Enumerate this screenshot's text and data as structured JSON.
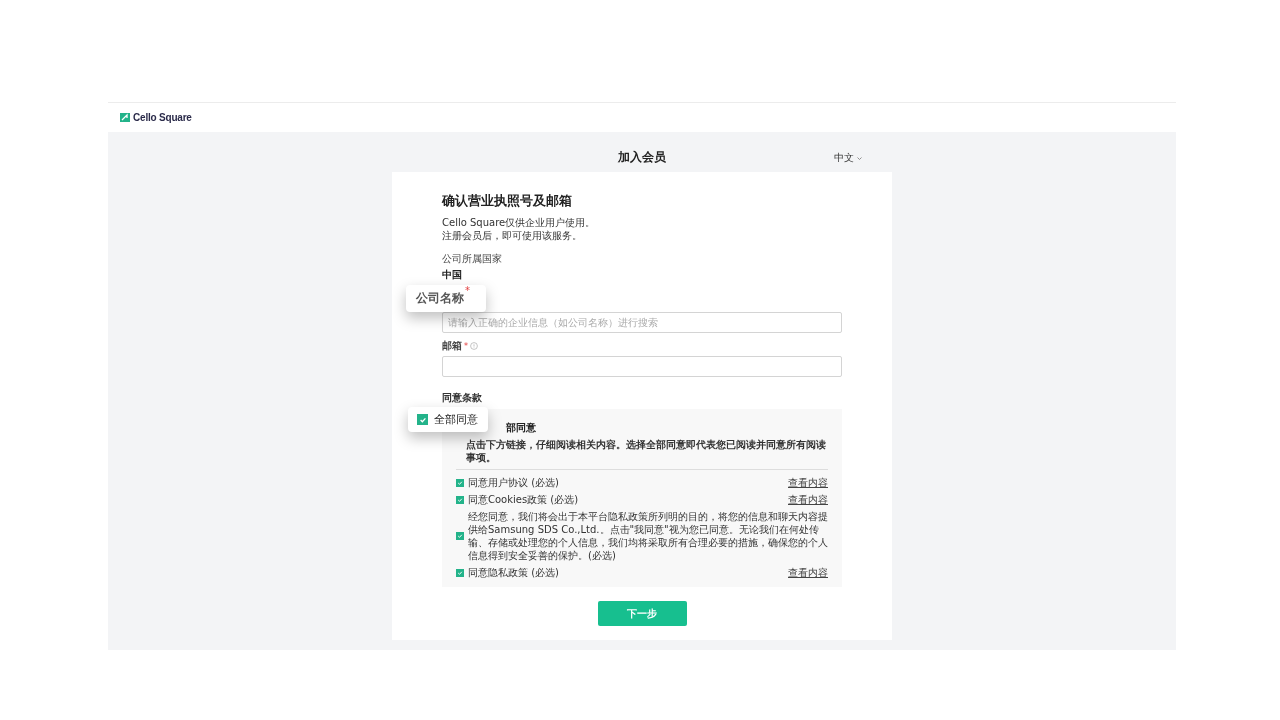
{
  "header": {
    "logo_text": "Cello Square"
  },
  "page": {
    "title": "加入会员",
    "language": "中文"
  },
  "form": {
    "heading": "确认营业执照号及邮箱",
    "intro": [
      "Cello Square仅供企业用户使用。",
      "注册会员后，即可使用该服务。"
    ],
    "country": {
      "label": "公司所属国家",
      "value": "中国"
    },
    "company": {
      "placeholder": "请输入正确的企业信息（如公司名称）进行搜索"
    },
    "email": {
      "label": "邮箱",
      "required_mark": "*"
    },
    "terms_label": "同意条款",
    "all_agree": {
      "label": "部同意",
      "description": "点击下方链接，仔细阅读相关内容。选择全部同意即代表您已阅读并同意所有阅读事项。"
    },
    "terms": [
      {
        "text": "同意用户协议 (必选)",
        "checked": true,
        "link": "查看内容"
      },
      {
        "text": "同意Cookies政策 (必选)",
        "checked": true,
        "link": "查看内容"
      },
      {
        "text": "经您同意，我们将会出于本平台隐私政策所列明的目的，将您的信息和聊天内容提供给Samsung SDS Co.,Ltd.。点击\"我同意\"视为您已同意。无论我们在何处传输、存储或处理您的个人信息，我们均将采取所有合理必要的措施，确保您的个人信息得到安全妥善的保护。(必选)",
        "checked": true
      },
      {
        "text": "同意隐私政策 (必选)",
        "checked": true,
        "link": "查看内容"
      }
    ],
    "next_button": "下一步"
  },
  "callouts": [
    {
      "kind": "label",
      "text": "公司名称",
      "required_mark": "*"
    },
    {
      "kind": "checkbox",
      "text": "全部同意",
      "checked": true
    }
  ]
}
